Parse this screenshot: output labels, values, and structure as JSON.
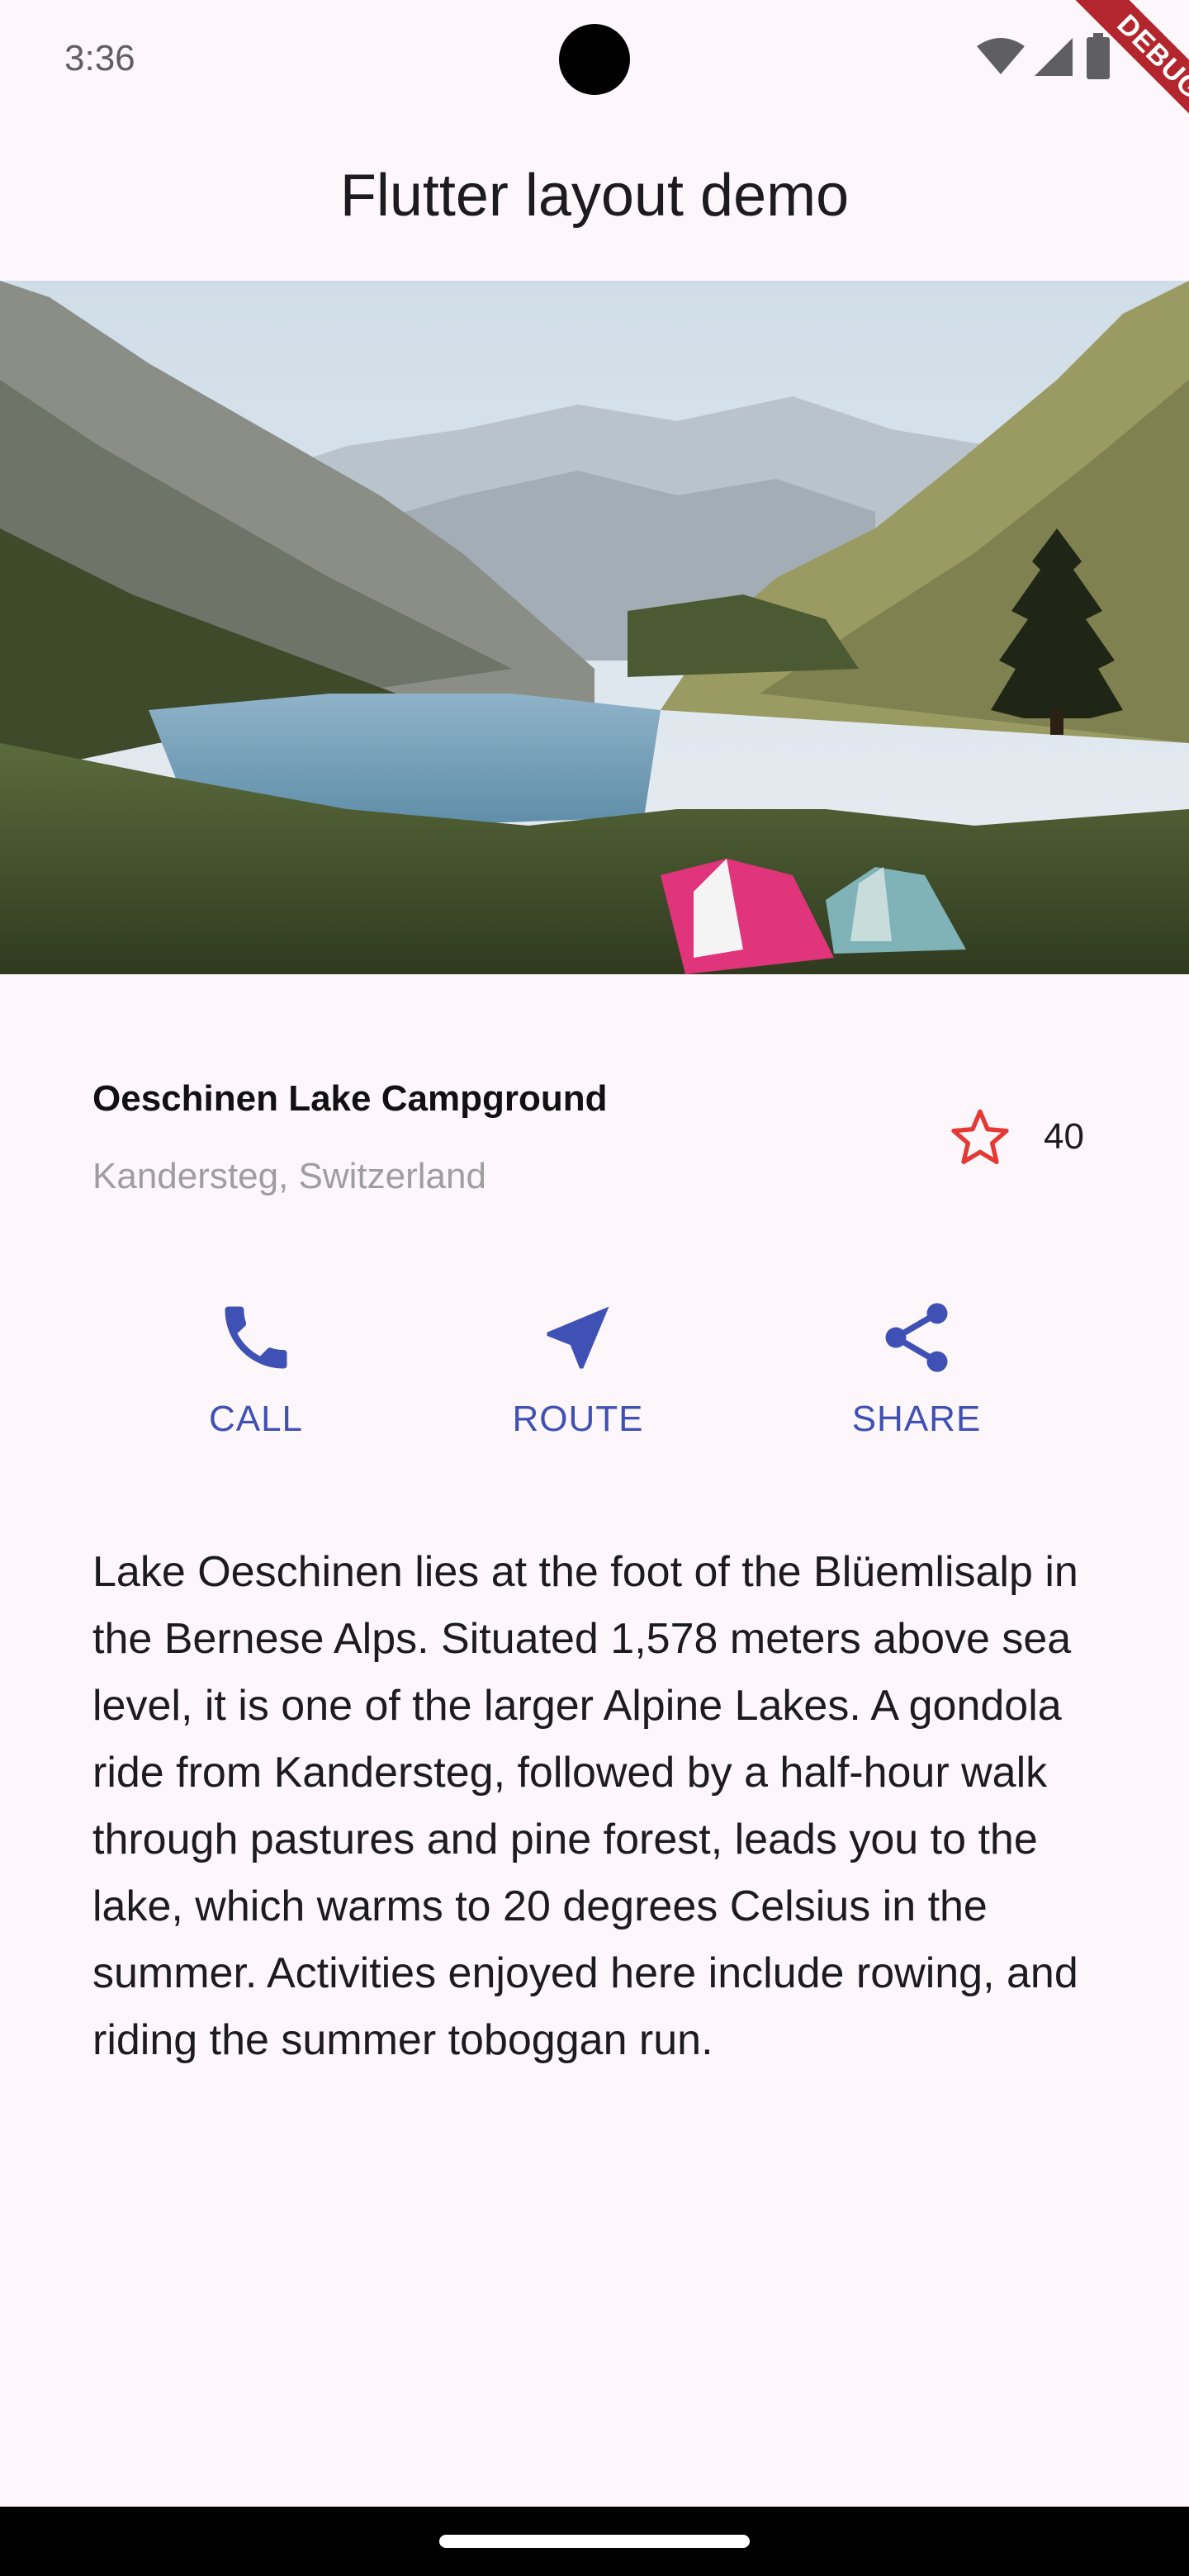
{
  "status_bar": {
    "time": "3:36",
    "icons": [
      "wifi-icon",
      "signal-icon",
      "battery-icon"
    ]
  },
  "debug_banner": {
    "label": "DEBUG"
  },
  "app_bar": {
    "title": "Flutter layout demo"
  },
  "hero_image": {
    "subject": "Alpine lake between mountains with two tents on grass"
  },
  "title_section": {
    "name": "Oeschinen Lake Campground",
    "location": "Kandersteg, Switzerland",
    "favorite_icon": "star-outline-icon",
    "favorite_count": "40"
  },
  "buttons": [
    {
      "label": "CALL",
      "icon": "phone-icon"
    },
    {
      "label": "ROUTE",
      "icon": "navigation-icon"
    },
    {
      "label": "SHARE",
      "icon": "share-icon"
    }
  ],
  "description": "Lake Oeschinen lies at the foot of the Blüemlisalp in the Bernese Alps. Situated 1,578 meters above sea level, it is one of the larger Alpine Lakes. A gondola ride from Kandersteg, followed by a half-hour walk through pastures and pine forest, leads you to the lake, which warms to 20 degrees Celsius in the summer. Activities enjoyed here include rowing, and riding the summer toboggan run.",
  "colors": {
    "background": "#fdf7fb",
    "accent": "#3f51b5",
    "star": "#e53935",
    "debug": "#b3262d",
    "secondary_text": "#9e9e9e"
  }
}
